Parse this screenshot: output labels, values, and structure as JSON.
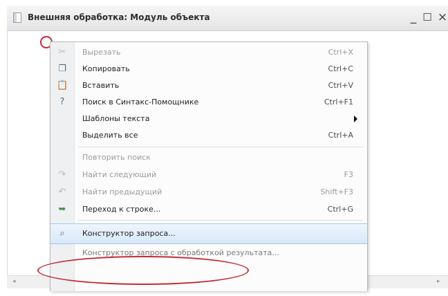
{
  "window": {
    "title": "Внешняя обработка: Модуль объекта",
    "minimize": "_",
    "maximize": "☐",
    "close": "×",
    "doc_icon": "document-icon"
  },
  "scrollbar": {
    "left": "◂",
    "right": "▸"
  },
  "menu": {
    "items": [
      {
        "label": "Вырезать",
        "shortcut": "Ctrl+X",
        "icon": "scissors-icon",
        "glyph": "✂"
      },
      {
        "label": "Копировать",
        "shortcut": "Ctrl+C",
        "icon": "copy-icon",
        "glyph": "❐"
      },
      {
        "label": "Вставить",
        "shortcut": "Ctrl+V",
        "icon": "paste-icon",
        "glyph": "📋"
      },
      {
        "label": "Поиск в Синтакс-Помощнике",
        "shortcut": "Ctrl+F1",
        "icon": "syntax-help-icon",
        "glyph": "?"
      },
      {
        "label": "Шаблоны текста",
        "shortcut": "",
        "icon": "",
        "glyph": ""
      },
      {
        "label": "Выделить все",
        "shortcut": "Ctrl+A",
        "icon": "",
        "glyph": ""
      },
      {
        "label": "Повторить поиск",
        "shortcut": "",
        "icon": "",
        "glyph": ""
      },
      {
        "label": "Найти следующий",
        "shortcut": "F3",
        "icon": "find-next-icon",
        "glyph": "↷"
      },
      {
        "label": "Найти предыдущий",
        "shortcut": "Shift+F3",
        "icon": "find-previous-icon",
        "glyph": "↶"
      },
      {
        "label": "Переход к строке...",
        "shortcut": "Ctrl+G",
        "icon": "goto-line-icon",
        "glyph": "➥"
      },
      {
        "label": "Конструктор запроса...",
        "shortcut": "",
        "icon": "query-builder-icon",
        "glyph": "⌕"
      }
    ],
    "next_item_partial": "Конструктор запроса с обработкой результата..."
  }
}
